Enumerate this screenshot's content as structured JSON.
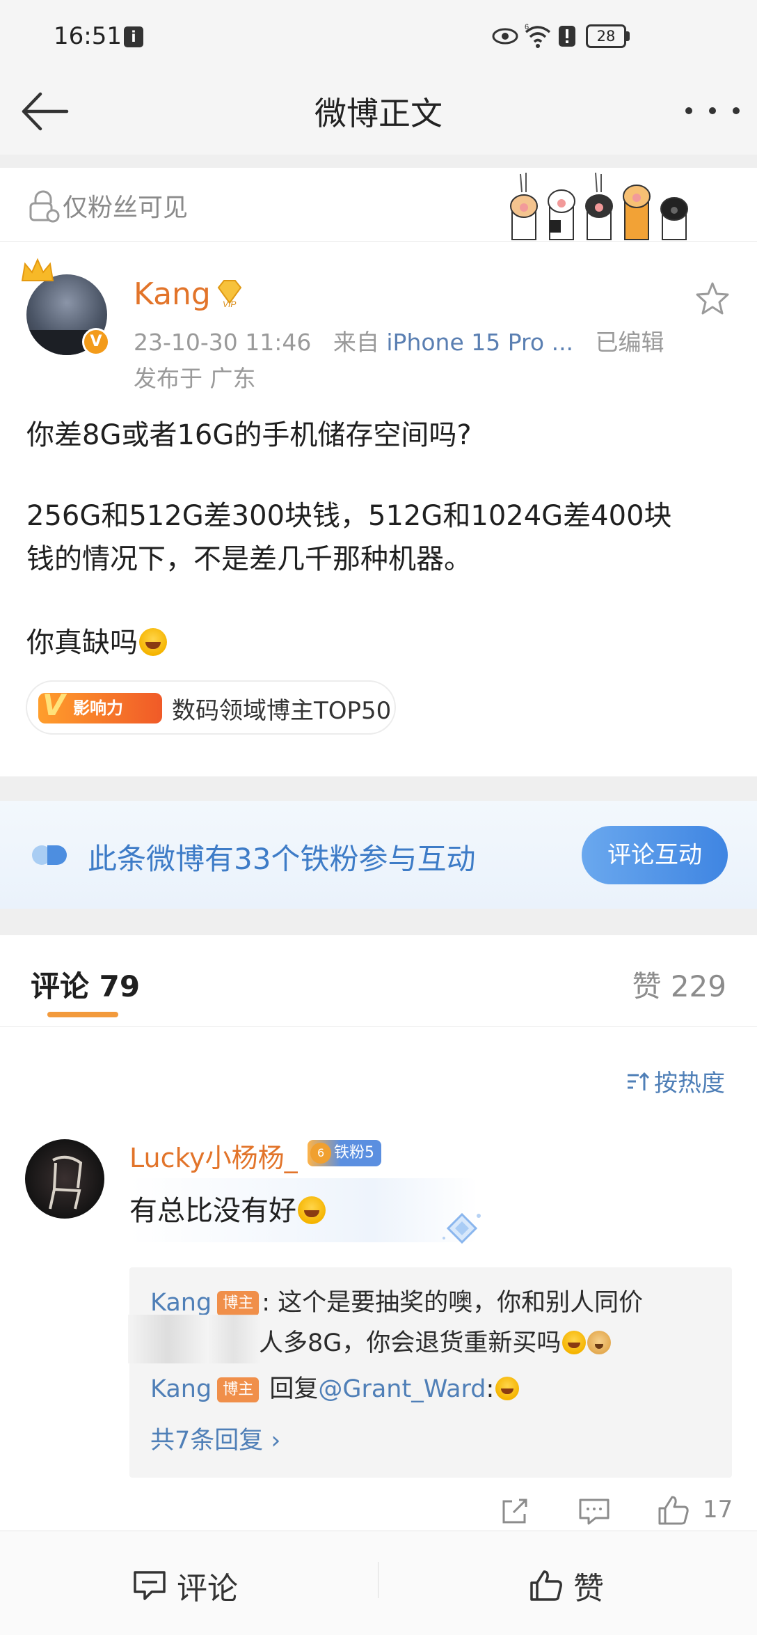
{
  "status_bar": {
    "time": "16:51",
    "network": "6",
    "battery": "28"
  },
  "nav": {
    "title": "微博正文"
  },
  "visibility": {
    "label": "仅粉丝可见"
  },
  "post": {
    "author": "Kang",
    "vip_label": "VIP",
    "verified_badge": "V",
    "timestamp": "23-10-30 11:46",
    "source_prefix": "来自",
    "device": "iPhone 15 Pro ...",
    "edited": "已编辑",
    "location": "发布于 广东",
    "lines": [
      "你差8G或者16G的手机储存空间吗?",
      "256G和512G差300块钱，512G和1024G差400块",
      "钱的情况下，不是差几千那种机器。",
      "你真缺吗"
    ],
    "tag_badge": "影响力",
    "tag_text": "数码领域博主TOP50"
  },
  "iron_fans": {
    "text": "此条微博有33个铁粉参与互动",
    "button": "评论互动"
  },
  "tabs": {
    "comments": "评论 79",
    "likes": "赞 229"
  },
  "sort": {
    "label": "按热度"
  },
  "comment": {
    "user": "Lucky小杨杨_",
    "fan_badge": "铁粉5",
    "fan_level": "6",
    "text": "有总比没有好",
    "replies": [
      {
        "name": "Kang",
        "badge": "博主",
        "text": ": 这个是要抽奖的噢，你和别人同价",
        "text2": "人多8G，你会退货重新买吗"
      },
      {
        "name": "Kang",
        "badge": "博主",
        "prefix": " 回复",
        "mention": "@Grant_Ward",
        "suffix": ":"
      }
    ],
    "more_replies": "共7条回复 ›",
    "like_count": "17"
  },
  "bottom_bar": {
    "comment": "评论",
    "like": "赞"
  }
}
